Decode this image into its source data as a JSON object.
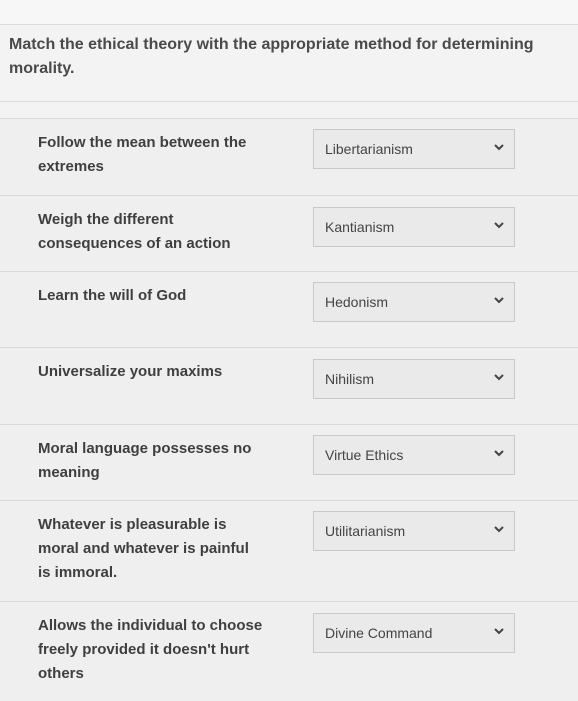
{
  "question": "Match the ethical theory with the appropriate method for determining morality.",
  "rows": [
    {
      "prompt": "Follow the mean between the extremes",
      "selected": "Libertarianism"
    },
    {
      "prompt": "Weigh the different consequences of an action",
      "selected": "Kantianism"
    },
    {
      "prompt": "Learn the will of God",
      "selected": "Hedonism"
    },
    {
      "prompt": "Universalize your maxims",
      "selected": "Nihilism"
    },
    {
      "prompt": "Moral language possesses no meaning",
      "selected": "Virtue Ethics"
    },
    {
      "prompt": "Whatever is pleasurable is moral and whatever is painful is immoral.",
      "selected": "Utilitarianism"
    },
    {
      "prompt": "Allows the individual to choose freely provided it doesn't hurt others",
      "selected": "Divine Command"
    }
  ],
  "icons": {
    "dropdown": "chevron-down-icon"
  }
}
